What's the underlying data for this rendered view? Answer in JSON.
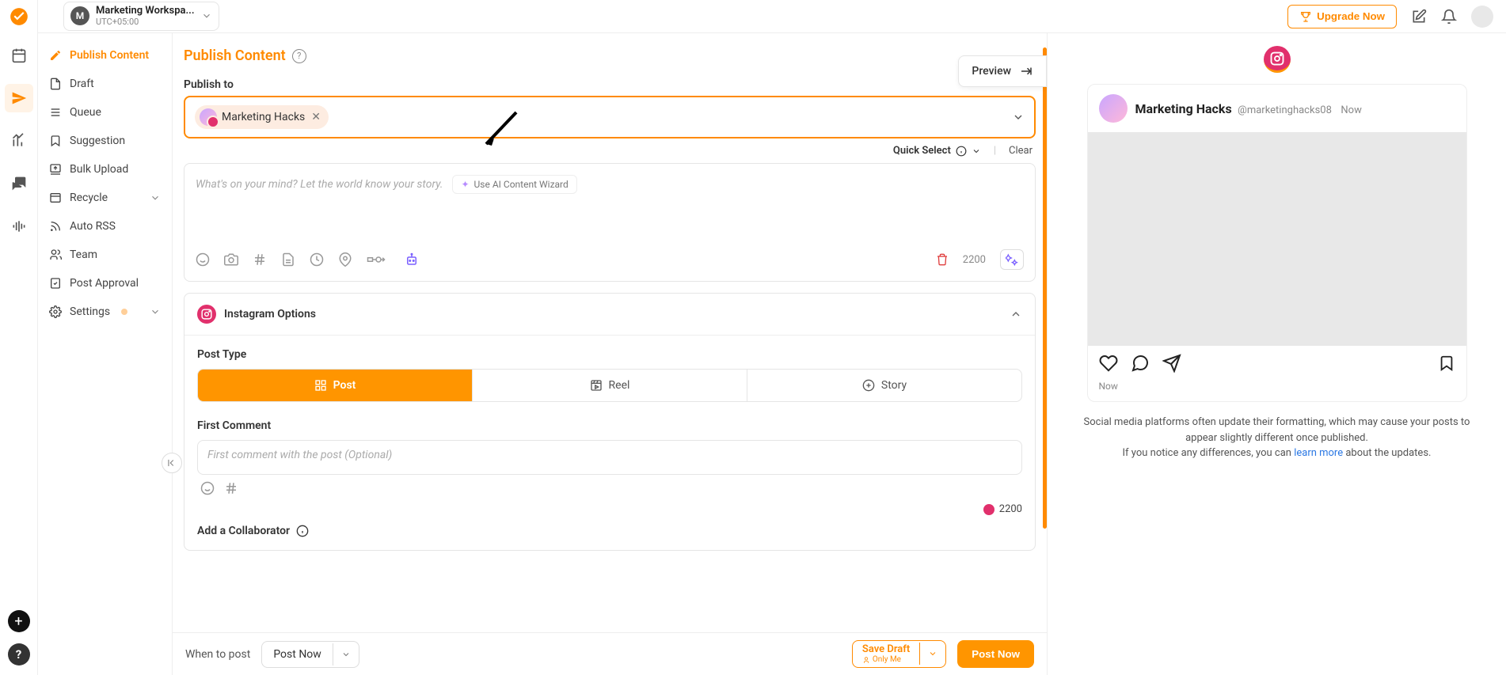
{
  "workspace": {
    "initial": "M",
    "name": "Marketing Workspa...",
    "tz": "UTC+05:00"
  },
  "topbar": {
    "upgrade": "Upgrade Now"
  },
  "sidebar": {
    "items": [
      {
        "label": "Publish Content"
      },
      {
        "label": "Draft"
      },
      {
        "label": "Queue"
      },
      {
        "label": "Suggestion"
      },
      {
        "label": "Bulk Upload"
      },
      {
        "label": "Recycle"
      },
      {
        "label": "Auto RSS"
      },
      {
        "label": "Team"
      },
      {
        "label": "Post Approval"
      },
      {
        "label": "Settings"
      }
    ]
  },
  "page": {
    "title": "Publish Content",
    "preview_btn": "Preview"
  },
  "publish": {
    "label": "Publish to",
    "account": "Marketing Hacks",
    "quick_select": "Quick Select",
    "clear": "Clear"
  },
  "composer": {
    "placeholder": "What's on your mind? Let the world know your story.",
    "ai_btn": "Use AI Content Wizard",
    "char_count": "2200"
  },
  "instagram": {
    "title": "Instagram Options",
    "post_type_label": "Post Type",
    "types": {
      "post": "Post",
      "reel": "Reel",
      "story": "Story"
    },
    "first_comment_label": "First Comment",
    "first_comment_placeholder": "First comment with the post (Optional)",
    "fc_count": "2200",
    "collab_label": "Add a Collaborator"
  },
  "footer": {
    "when_label": "When to post",
    "when_value": "Post Now",
    "save_draft": "Save Draft",
    "save_draft_sub": "Only Me",
    "post_now": "Post Now"
  },
  "preview": {
    "account": "Marketing Hacks",
    "handle": "@marketinghacks08",
    "time": "Now",
    "timestamp": "Now",
    "disclaimer1": "Social media platforms often update their formatting, which may cause your posts to appear slightly different once published.",
    "disclaimer2a": "If you notice any differences, you can ",
    "learn_more": "learn more",
    "disclaimer2b": " about the updates."
  }
}
